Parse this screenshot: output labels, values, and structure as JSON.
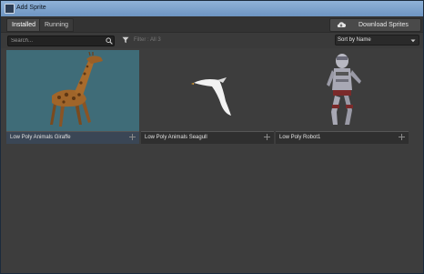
{
  "window": {
    "title": "Add Sprite"
  },
  "tabs": [
    {
      "label": "Installed",
      "active": true
    },
    {
      "label": "Running",
      "active": false
    }
  ],
  "download_button": {
    "label": "Download Sprites",
    "icon": "cloud-download-icon"
  },
  "search": {
    "placeholder": "Search...",
    "value": ""
  },
  "filter": {
    "text": "Filter : All 3",
    "icon": "filter-icon"
  },
  "sort": {
    "selected": "Sort by Name"
  },
  "sprites": [
    {
      "name": "Low Poly Animals Giraffe",
      "selected": true
    },
    {
      "name": "Low Poly Animals Seagull",
      "selected": false
    },
    {
      "name": "Low Poly Robot1",
      "selected": false
    }
  ],
  "colors": {
    "selected_thumb_bg": "#3f6c78",
    "panel_bg": "#3d3d3d"
  }
}
